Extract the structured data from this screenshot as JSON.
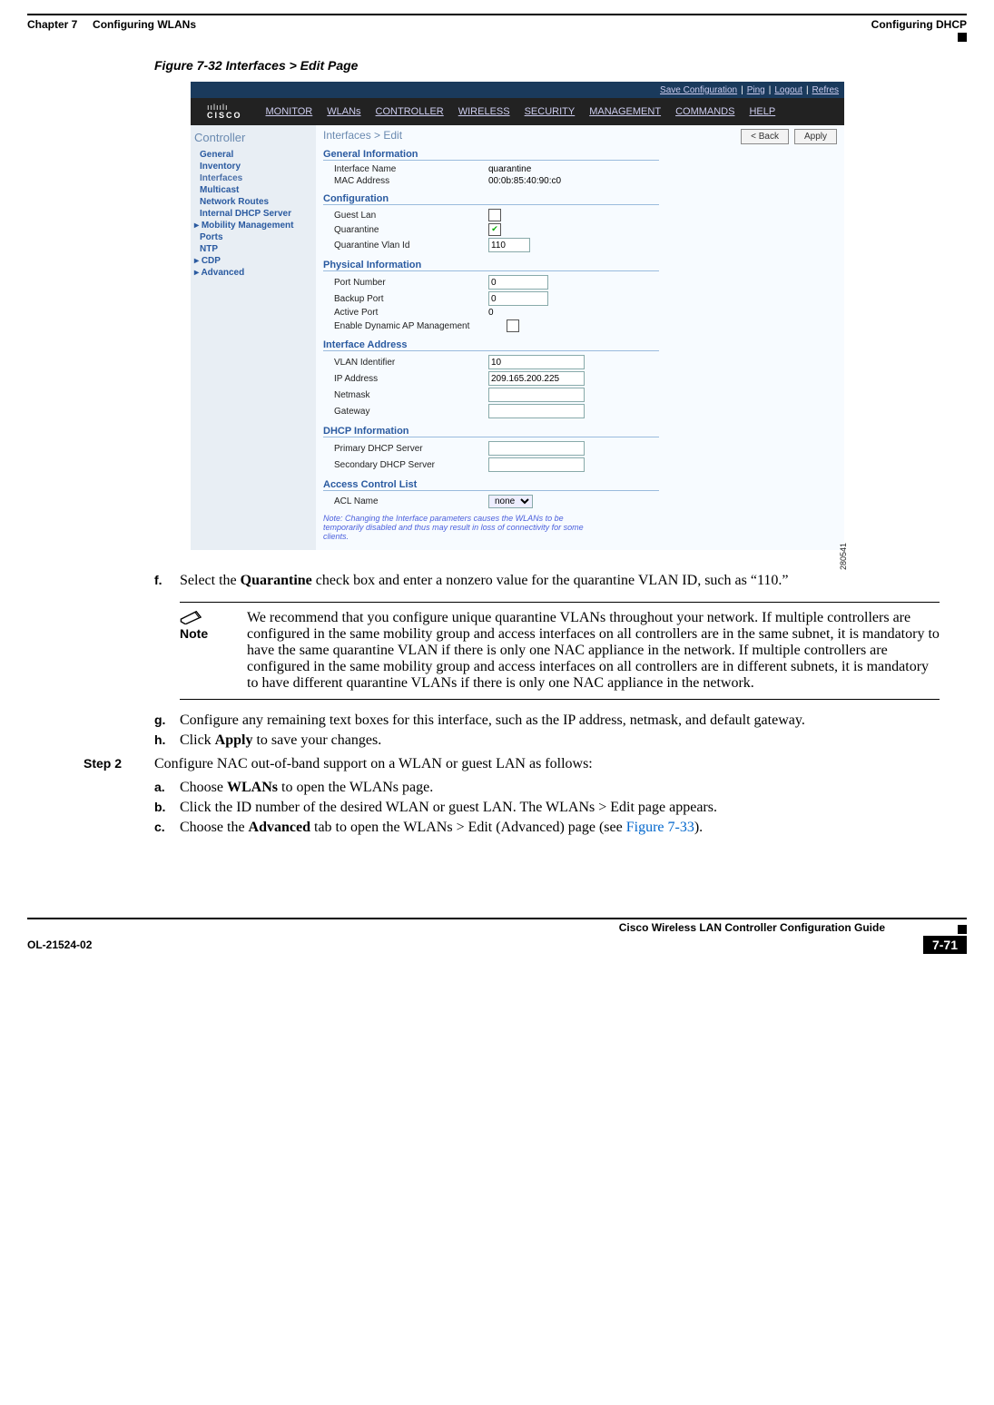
{
  "header": {
    "chapter": "Chapter 7",
    "title": "Configuring WLANs",
    "section": "Configuring DHCP"
  },
  "figure": {
    "caption": "Figure 7-32   Interfaces > Edit Page"
  },
  "screenshot": {
    "topbar": {
      "save": "Save Configuration",
      "ping": "Ping",
      "logout": "Logout",
      "refresh": "Refres"
    },
    "logo_top": "ıılıılı",
    "logo_bot": "CISCO",
    "menu": [
      "MONITOR",
      "WLANs",
      "CONTROLLER",
      "WIRELESS",
      "SECURITY",
      "MANAGEMENT",
      "COMMANDS",
      "HELP"
    ],
    "nav_title": "Controller",
    "nav_items": [
      "General",
      "Inventory",
      "Interfaces",
      "Multicast",
      "Network Routes",
      "Internal DHCP Server",
      "Mobility Management",
      "Ports",
      "NTP",
      "CDP",
      "Advanced"
    ],
    "page_title": "Interfaces > Edit",
    "back_btn": "< Back",
    "apply_btn": "Apply",
    "sections": {
      "gen_info": "General Information",
      "config": "Configuration",
      "phys": "Physical Information",
      "addr": "Interface Address",
      "dhcp": "DHCP Information",
      "acl": "Access Control List"
    },
    "fields": {
      "iface_name_lbl": "Interface Name",
      "iface_name_val": "quarantine",
      "mac_lbl": "MAC Address",
      "mac_val": "00:0b:85:40:90:c0",
      "guest_lbl": "Guest Lan",
      "quarantine_lbl": "Quarantine",
      "qvlan_lbl": "Quarantine Vlan Id",
      "qvlan_val": "110",
      "port_lbl": "Port Number",
      "port_val": "0",
      "backup_lbl": "Backup Port",
      "backup_val": "0",
      "active_lbl": "Active Port",
      "active_val": "0",
      "dynap_lbl": "Enable Dynamic AP Management",
      "vlan_lbl": "VLAN Identifier",
      "vlan_val": "10",
      "ip_lbl": "IP Address",
      "ip_val": "209.165.200.225",
      "netmask_lbl": "Netmask",
      "gateway_lbl": "Gateway",
      "pri_dhcp_lbl": "Primary DHCP Server",
      "sec_dhcp_lbl": "Secondary DHCP Server",
      "acl_lbl": "ACL Name",
      "acl_val": "none"
    },
    "note": "Note: Changing the Interface parameters causes the WLANs to be temporarily disabled and thus may result in loss of connectivity for some clients.",
    "side_caption": "280541"
  },
  "steps": {
    "f": {
      "mark": "f.",
      "text_1": "Select the ",
      "bold": "Quarantine",
      "text_2": " check box and enter a nonzero value for the quarantine VLAN ID, such as “110.”"
    },
    "note_label": "Note",
    "note_text": "We recommend that you configure unique quarantine VLANs throughout your network. If multiple controllers are configured in the same mobility group and access interfaces on all controllers are in the same subnet, it is mandatory to have the same quarantine VLAN if there is only one NAC appliance in the network. If multiple controllers are configured in the same mobility group and access interfaces on all controllers are in different subnets, it is mandatory to have different quarantine VLANs if there is only one NAC appliance in the network.",
    "g": {
      "mark": "g.",
      "text": "Configure any remaining text boxes for this interface, such as the IP address, netmask, and default gateway."
    },
    "h": {
      "mark": "h.",
      "text_1": "Click ",
      "bold": "Apply",
      "text_2": " to save your changes."
    },
    "step2_mark": "Step 2",
    "step2_text": "Configure NAC out-of-band support on a WLAN or guest LAN as follows:",
    "a": {
      "mark": "a.",
      "text_1": "Choose ",
      "bold": "WLANs",
      "text_2": " to open the WLANs page."
    },
    "b": {
      "mark": "b.",
      "text": "Click the ID number of the desired WLAN or guest LAN. The WLANs > Edit page appears."
    },
    "c": {
      "mark": "c.",
      "text_1": "Choose the ",
      "bold": "Advanced",
      "text_2": " tab to open the WLANs > Edit (Advanced) page (see ",
      "link": "Figure 7-33",
      "text_3": ")."
    }
  },
  "footer": {
    "guide": "Cisco Wireless LAN Controller Configuration Guide",
    "docnum": "OL-21524-02",
    "pagenum": "7-71"
  }
}
